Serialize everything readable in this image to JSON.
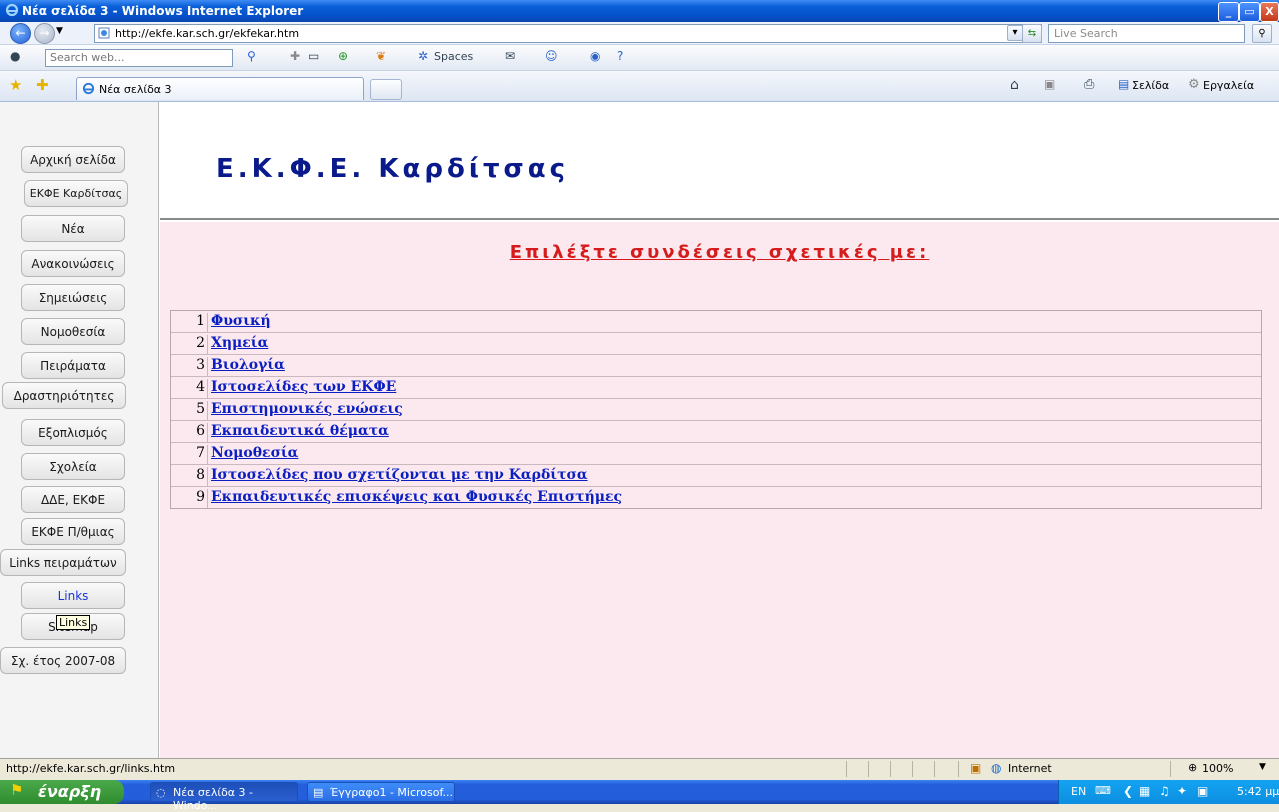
{
  "window": {
    "title": "Νέα σελίδα 3 - Windows Internet Explorer",
    "minimize": "_",
    "maximize": "▭",
    "close": "X"
  },
  "address": {
    "url": "http://ekfe.kar.sch.gr/ekfekar.htm",
    "live_search_placeholder": "Live Search"
  },
  "toolbar": {
    "search_placeholder": "Search web...",
    "spaces_label": "Spaces"
  },
  "tabs": {
    "active_tab": "Νέα σελίδα 3",
    "page_menu": "Σελίδα",
    "tools_menu": "Εργαλεία"
  },
  "page": {
    "site_title": "Ε.Κ.Φ.Ε. Καρδίτσας",
    "heading": "Επιλέξτε συνδέσεις σχετικές με:",
    "nav": [
      {
        "label": "Αρχική σελίδα"
      },
      {
        "label": "ΕΚΦΕ Καρδίτσας"
      },
      {
        "label": "Νέα"
      },
      {
        "label": "Ανακοινώσεις"
      },
      {
        "label": "Σημειώσεις"
      },
      {
        "label": "Νομοθεσία"
      },
      {
        "label": "Πειράματα"
      },
      {
        "label": "Δραστηριότητες"
      },
      {
        "label": "Εξοπλισμός"
      },
      {
        "label": "Σχολεία"
      },
      {
        "label": "ΔΔΕ, ΕΚΦΕ"
      },
      {
        "label": "ΕΚΦΕ Π/θμιας"
      },
      {
        "label": "Links πειραμάτων"
      },
      {
        "label": "Links"
      },
      {
        "label": "Sitemap"
      },
      {
        "label": "Σχ. έτος 2007-08"
      }
    ],
    "tooltip": "Links",
    "links": [
      {
        "num": "1",
        "label": "Φυσική"
      },
      {
        "num": "2",
        "label": "Χημεία"
      },
      {
        "num": "3",
        "label": "Βιολογία"
      },
      {
        "num": "4",
        "label": "Ιστοσελίδες των ΕΚΦΕ"
      },
      {
        "num": "5",
        "label": "Επιστημονικές ενώσεις"
      },
      {
        "num": "6",
        "label": "Εκπαιδευτικά θέματα"
      },
      {
        "num": "7",
        "label": "Νομοθεσία"
      },
      {
        "num": "8",
        "label": "Ιστοσελίδες που σχετίζονται με την Καρδίτσα"
      },
      {
        "num": "9",
        "label": "Εκπαιδευτικές επισκέψεις και Φυσικές Επιστήμες"
      }
    ]
  },
  "status": {
    "text": "http://ekfe.kar.sch.gr/links.htm",
    "zone": "Internet",
    "zoom": "100%"
  },
  "taskbar": {
    "start": "έναρξη",
    "tasks": [
      {
        "label": "Νέα σελίδα 3 - Windo..."
      },
      {
        "label": "Έγγραφο1 - Microsof..."
      }
    ],
    "lang": "EN",
    "clock": "5:42 μμ"
  },
  "colors": {
    "content_bg": "#fbe9ef",
    "heading": "#d51b1b",
    "title": "#0a1a8a",
    "link": "#0a1ec2"
  }
}
